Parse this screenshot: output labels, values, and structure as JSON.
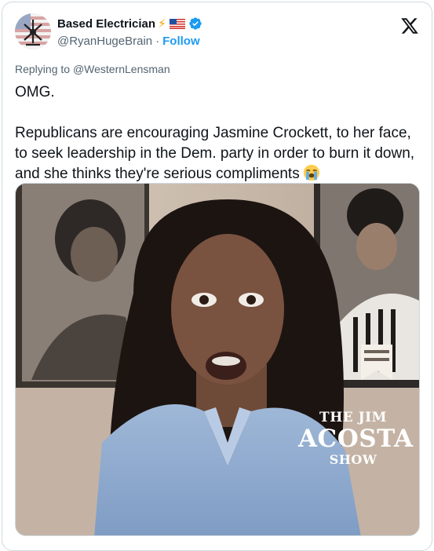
{
  "tweet": {
    "author": {
      "display_name": "Based Electrician",
      "name_emoji": "⚡",
      "flag_icon": "us-flag-icon",
      "verified_icon": "verified-badge-icon",
      "handle": "@RyanHugeBrain",
      "separator": "·",
      "follow_label": "Follow"
    },
    "brand_icon": "x-logo-icon",
    "replying_prefix": "Replying to ",
    "replying_to": "@WesternLensman",
    "text_line1": "OMG.",
    "text_line2": "Republicans are encouraging Jasmine Crockett, to her face, to seek leadership in the Dem. party in order to burn it down, and she thinks they're serious compliments",
    "text_emoji": "loudly-crying-face-emoji",
    "media": {
      "overlay_line1": "THE JIM",
      "overlay_line2": "ACOSTA",
      "overlay_line3": "SHOW"
    }
  },
  "colors": {
    "accent": "#1d9bf0",
    "text": "#0f1419",
    "secondary": "#536471",
    "border": "#cfd9de"
  }
}
